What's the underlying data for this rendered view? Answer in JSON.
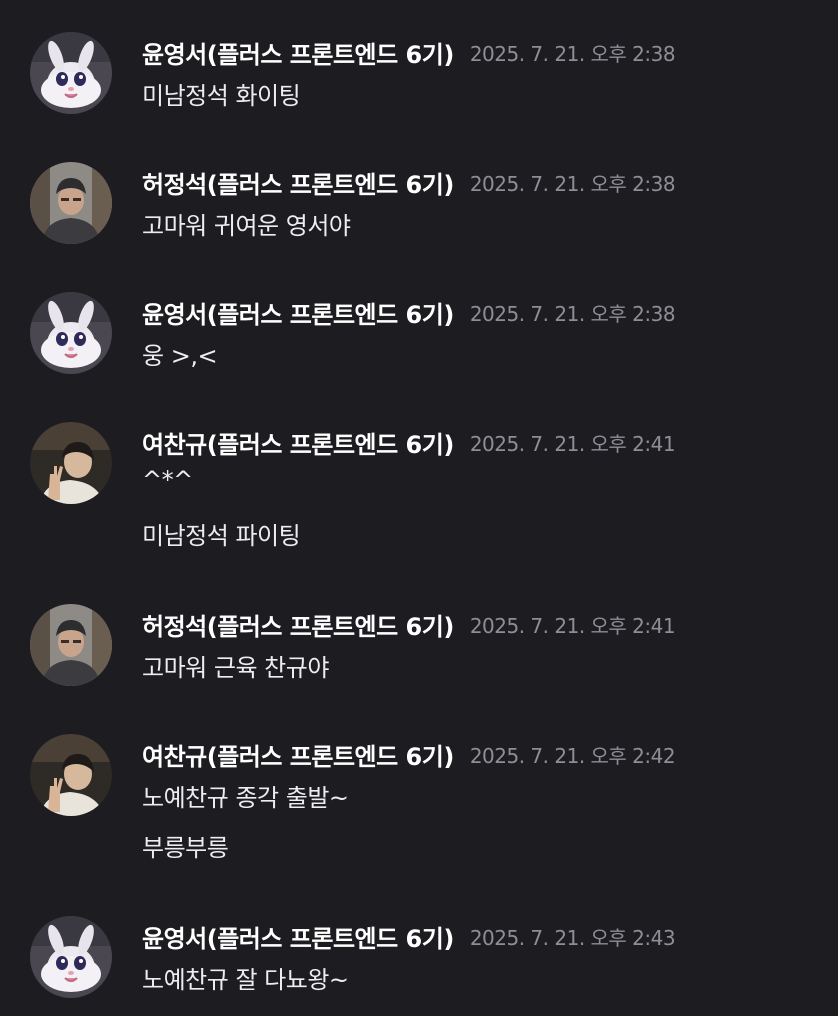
{
  "messages": [
    {
      "author": "윤영서(플러스 프론트엔드 6기)",
      "time": "2025. 7. 21. 오후 2:38",
      "avatar": "white-bunny-avatar",
      "lines": [
        "미남정석 화이팅"
      ]
    },
    {
      "author": "허정석(플러스 프론트엔드 6기)",
      "time": "2025. 7. 21. 오후 2:38",
      "avatar": "man-beanie-avatar",
      "lines": [
        "고마워 귀여운 영서야"
      ]
    },
    {
      "author": "윤영서(플러스 프론트엔드 6기)",
      "time": "2025. 7. 21. 오후 2:38",
      "avatar": "white-bunny-avatar",
      "lines": [
        "웅 >,<"
      ]
    },
    {
      "author": "여찬규(플러스 프론트엔드 6기)",
      "time": "2025. 7. 21. 오후 2:41",
      "avatar": "peace-sign-avatar",
      "lines": [
        "^*^",
        "미남정석 파이팅"
      ]
    },
    {
      "author": "허정석(플러스 프론트엔드 6기)",
      "time": "2025. 7. 21. 오후 2:41",
      "avatar": "man-beanie-avatar",
      "lines": [
        "고마워 근육 찬규야"
      ]
    },
    {
      "author": "여찬규(플러스 프론트엔드 6기)",
      "time": "2025. 7. 21. 오후 2:42",
      "avatar": "peace-sign-avatar",
      "lines": [
        "노예찬규 종각 출발~",
        "부릉부릉"
      ]
    },
    {
      "author": "윤영서(플러스 프론트엔드 6기)",
      "time": "2025. 7. 21. 오후 2:43",
      "avatar": "white-bunny-avatar",
      "lines": [
        "노예찬규 잘 다뇨왕~"
      ]
    }
  ],
  "colors": {
    "background": "#1c1c21",
    "author": "#ffffff",
    "timestamp": "#8e8e95",
    "text": "#ededf0"
  }
}
